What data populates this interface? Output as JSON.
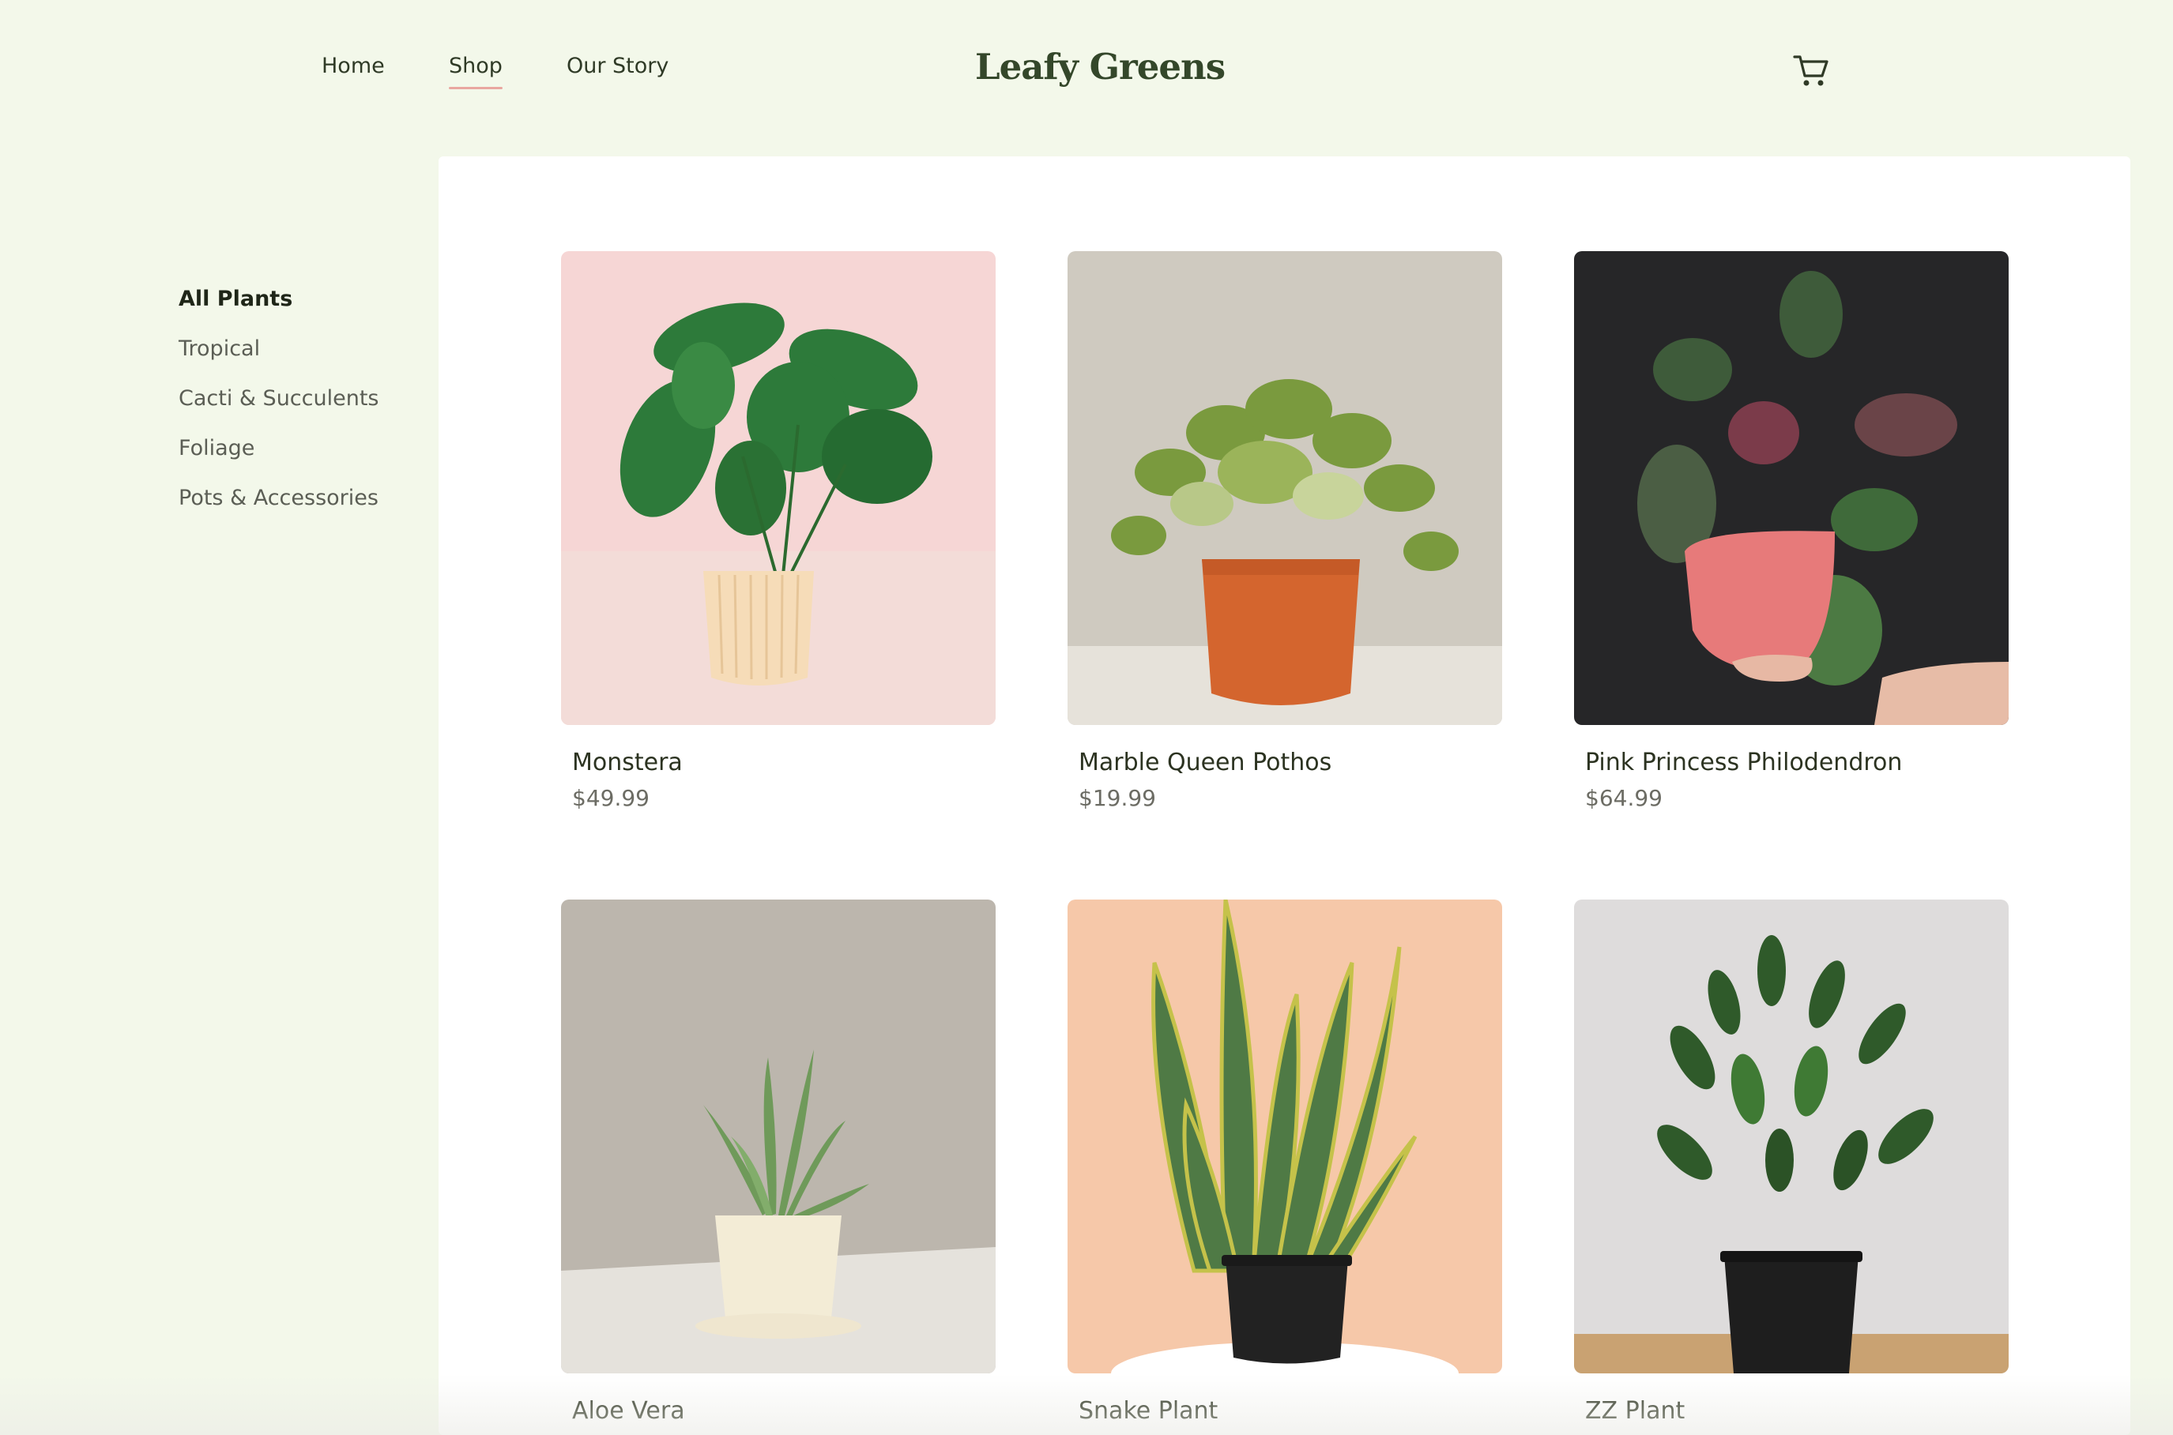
{
  "header": {
    "nav": [
      "Home",
      "Shop",
      "Our Story"
    ],
    "active_nav": "Shop",
    "brand": "Leafy Greens",
    "cart_icon": "cart-icon"
  },
  "sidebar": {
    "categories": [
      "All Plants",
      "Tropical",
      "Cacti & Succulents",
      "Foliage",
      "Pots & Accessories"
    ],
    "active": "All Plants"
  },
  "products": [
    {
      "name": "Monstera",
      "price": "$49.99"
    },
    {
      "name": "Marble Queen Pothos",
      "price": "$19.99"
    },
    {
      "name": "Pink Princess Philodendron",
      "price": "$64.99"
    },
    {
      "name": "Aloe Vera",
      "price": ""
    },
    {
      "name": "Snake Plant",
      "price": ""
    },
    {
      "name": "ZZ Plant",
      "price": ""
    }
  ],
  "colors": {
    "page_bg": "#f3f8ea",
    "accent_underline": "#e9a7a0",
    "brand": "#34472a"
  }
}
